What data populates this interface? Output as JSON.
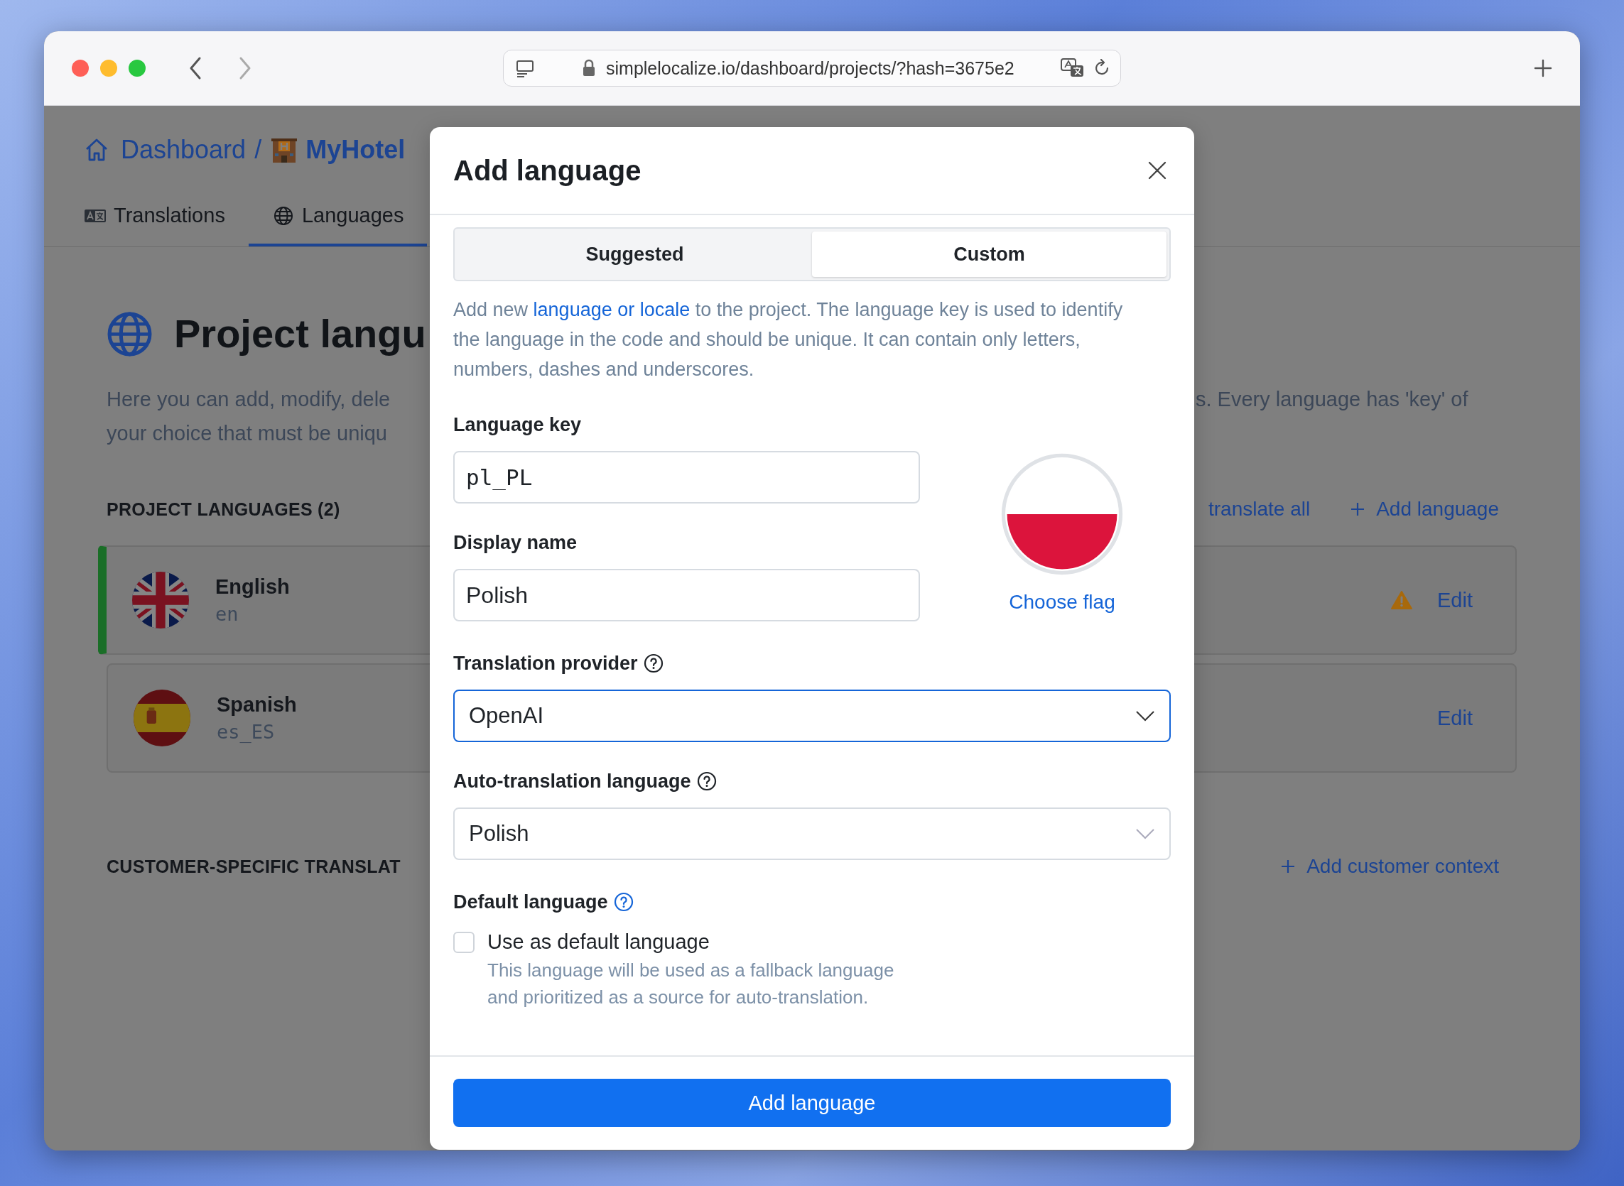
{
  "browser": {
    "url": "simplelocalize.io/dashboard/projects/?hash=3675e2"
  },
  "page": {
    "breadcrumb": {
      "items": [
        {
          "label": "Dashboard",
          "kind": "home"
        },
        {
          "label": "MyHotel",
          "kind": "hotel"
        }
      ],
      "separator": "/"
    },
    "tabs": [
      {
        "label": "Translations",
        "kind": "translations",
        "selected": false
      },
      {
        "label": "Languages",
        "kind": "languages",
        "selected": true
      }
    ],
    "title": "Project langu",
    "description": {
      "left": [
        "Here you can add, modify, dele",
        "your choice that must be uniqu"
      ],
      "right": [
        "s. Every language has 'key' of"
      ]
    },
    "languages_section": {
      "title": "PROJECT LANGUAGES (2)",
      "actions": [
        {
          "label": "translate all",
          "kind": "link"
        },
        {
          "label": "Add language",
          "kind": "add"
        }
      ],
      "languages": [
        {
          "name": "English",
          "key": "en",
          "flag": {
            "kind": "gb"
          },
          "default": true,
          "warning": true,
          "action": "Edit"
        },
        {
          "name": "Spanish",
          "key": "es_ES",
          "flag": {
            "kind": "es"
          },
          "default": false,
          "warning": false,
          "action": "Edit"
        }
      ]
    },
    "customer_section": {
      "title": "CUSTOMER-SPECIFIC TRANSLAT",
      "action": "Add customer context"
    }
  },
  "dialog": {
    "title": "Add language",
    "tabs": [
      {
        "label": "Suggested",
        "selected": false
      },
      {
        "label": "Custom",
        "selected": true
      }
    ],
    "intro": {
      "before": "Add new ",
      "link": "language or locale",
      "after": " to the project. The language key is used to identify the language in the code and should be unique. It can contain only letters, numbers, dashes and underscores."
    },
    "language_key": {
      "label": "Language key",
      "value": "pl_PL"
    },
    "display_name": {
      "label": "Display name",
      "value": "Polish"
    },
    "flag": {
      "kind": "pl",
      "action": "Choose flag"
    },
    "translation_provider": {
      "label": "Translation provider",
      "value": "OpenAI",
      "focused": true,
      "help": {
        "kind": "plain"
      }
    },
    "auto_translation_language": {
      "label": "Auto-translation language",
      "value": "Polish",
      "focused": false,
      "help": {
        "kind": "plain"
      }
    },
    "default_language": {
      "label": "Default language",
      "help": {
        "kind": "accent"
      },
      "option": {
        "label": "Use as default language",
        "checked": false,
        "hint": "This language will be used as a fallback language and prioritized as a source for auto-translation."
      }
    },
    "submit": "Add language"
  }
}
